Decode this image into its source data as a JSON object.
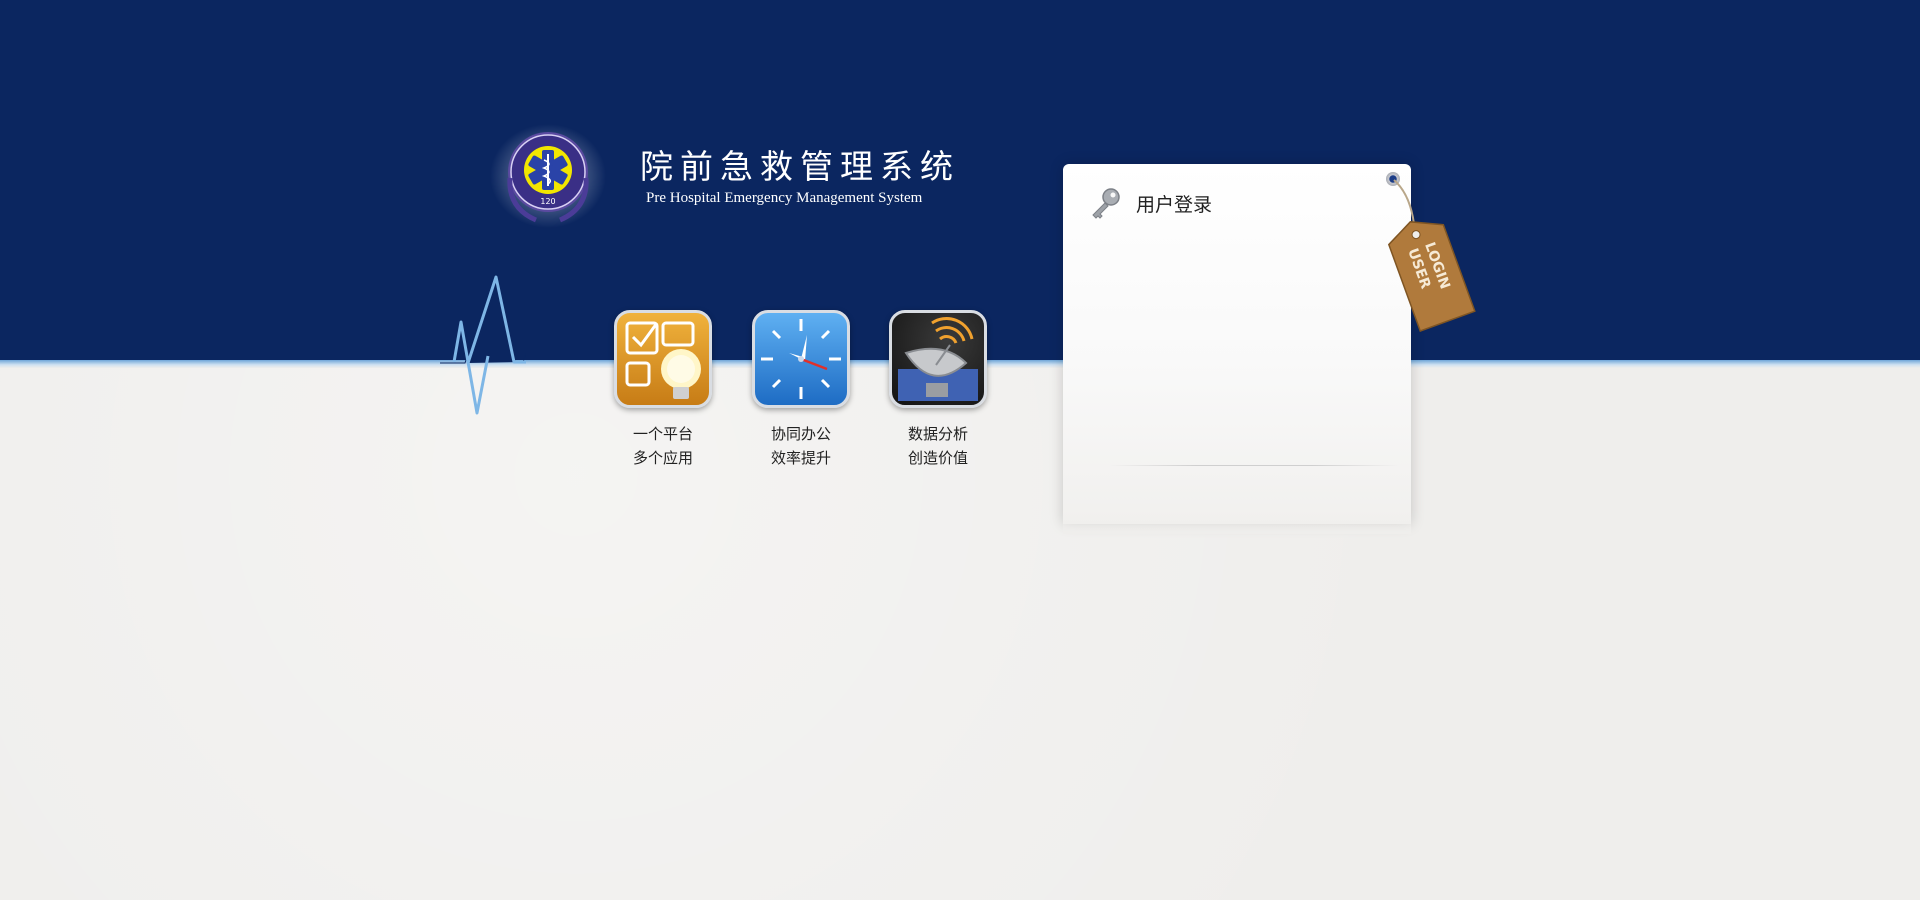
{
  "header": {
    "title_cn": "院前急救管理系统",
    "title_en": "Pre Hospital Emergency Management System",
    "emblem_text": "120",
    "emblem_icon": "emergency-star-of-life-emblem"
  },
  "features": [
    {
      "icon": "checklist-lightbulb-icon",
      "caption": "一个平台\n多个应用"
    },
    {
      "icon": "compass-clock-icon",
      "caption": "协同办公\n效率提升"
    },
    {
      "icon": "satellite-dish-icon",
      "caption": "数据分析\n创造价值"
    }
  ],
  "login": {
    "title": "用户登录",
    "icon": "key-icon",
    "tag_text_line1": "USER",
    "tag_text_line2": "LOGIN"
  },
  "colors": {
    "navy": "#0b2660",
    "page_bg": "#efeeec",
    "accent_blue": "#6fa6d8",
    "tag_brown": "#b07a3c"
  }
}
